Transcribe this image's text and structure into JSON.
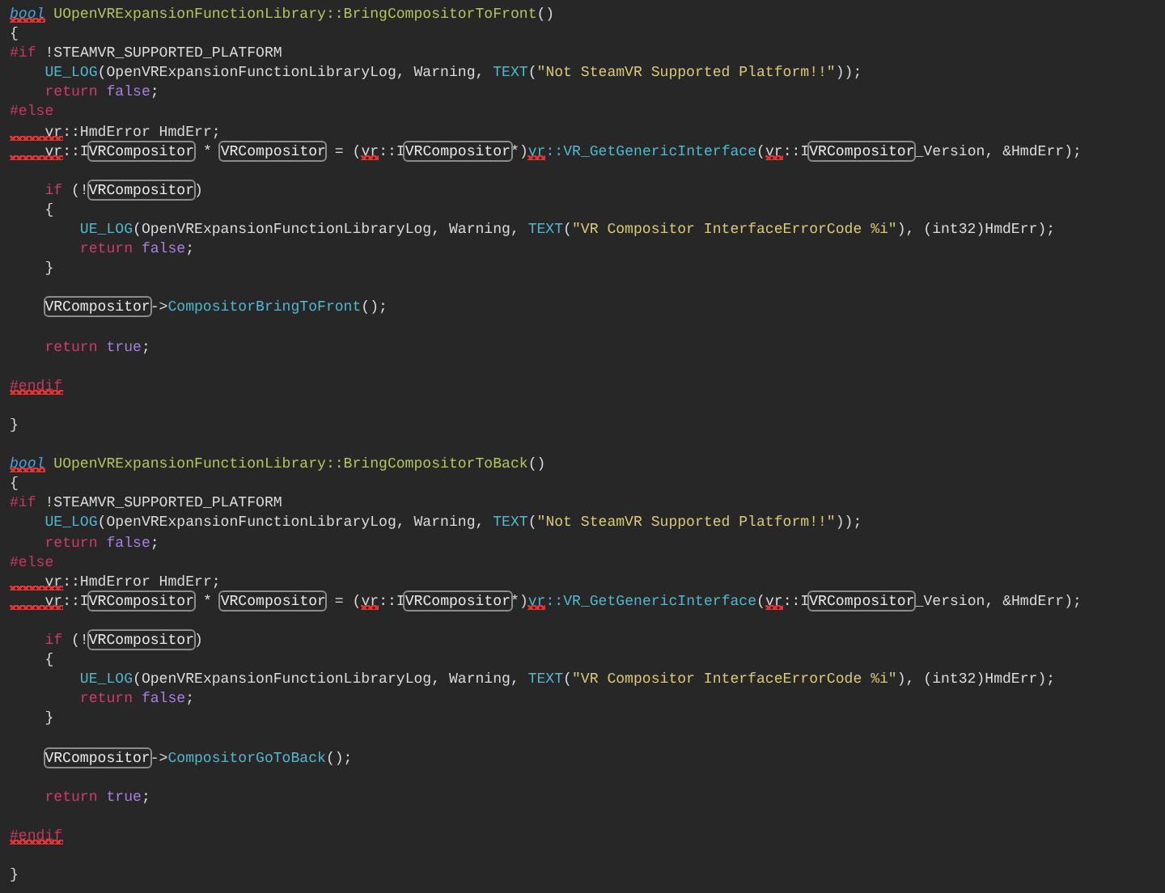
{
  "editor": {
    "lines": [
      {
        "kind": "code",
        "tokens": [
          {
            "text": "bool",
            "kind": "type",
            "error": true
          },
          {
            "text": " UOpenVRExpansionFunctionLibrary::BringCompositorToFront",
            "kind": "definition",
            "error": false
          },
          {
            "text": "()",
            "kind": "plain",
            "error": false
          }
        ]
      },
      {
        "kind": "code",
        "tokens": [
          {
            "text": "{",
            "kind": "plain",
            "error": false
          }
        ]
      },
      {
        "kind": "code",
        "tokens": [
          {
            "text": "#if",
            "kind": "preprocessor",
            "error": false
          },
          {
            "text": " !STEAMVR_SUPPORTED_PLATFORM",
            "kind": "plain",
            "error": false
          }
        ]
      },
      {
        "kind": "code",
        "tokens": [
          {
            "text": "    UE_LOG",
            "kind": "call",
            "error": false
          },
          {
            "text": "(OpenVRExpansionFunctionLibraryLog, Warning, ",
            "kind": "plain",
            "error": false
          },
          {
            "text": "TEXT",
            "kind": "call",
            "error": false
          },
          {
            "text": "(",
            "kind": "plain",
            "error": false
          },
          {
            "text": "\"Not SteamVR Supported Platform!!\"",
            "kind": "string",
            "error": false
          },
          {
            "text": "));",
            "kind": "plain",
            "error": false
          }
        ]
      },
      {
        "kind": "code",
        "tokens": [
          {
            "text": "    return",
            "kind": "keyword",
            "error": false
          },
          {
            "text": " false",
            "kind": "literal",
            "error": false
          },
          {
            "text": ";",
            "kind": "plain",
            "error": false
          }
        ]
      },
      {
        "kind": "code",
        "tokens": [
          {
            "text": "#else",
            "kind": "preprocessor",
            "error": false
          }
        ]
      },
      {
        "kind": "code",
        "tokens": [
          {
            "text": "    vr",
            "kind": "plain",
            "error": true
          },
          {
            "text": "::HmdError HmdErr;",
            "kind": "plain",
            "error": false
          }
        ]
      },
      {
        "kind": "code",
        "tokens": [
          {
            "text": "    vr",
            "kind": "plain",
            "error": true
          },
          {
            "text": "::I",
            "kind": "plain",
            "error": false
          },
          {
            "text": "VRCompositor",
            "kind": "match",
            "error": false
          },
          {
            "text": " * ",
            "kind": "plain",
            "error": false
          },
          {
            "text": "VRCompositor",
            "kind": "match",
            "error": false
          },
          {
            "text": " = (",
            "kind": "plain",
            "error": false
          },
          {
            "text": "vr",
            "kind": "plain",
            "error": true
          },
          {
            "text": "::I",
            "kind": "plain",
            "error": false
          },
          {
            "text": "VRCompositor",
            "kind": "match",
            "error": false
          },
          {
            "text": "*)",
            "kind": "plain",
            "error": false
          },
          {
            "text": "vr",
            "kind": "call",
            "error": true
          },
          {
            "text": "::VR_GetGenericInterface",
            "kind": "call",
            "error": false
          },
          {
            "text": "(",
            "kind": "plain",
            "error": false
          },
          {
            "text": "vr",
            "kind": "plain",
            "error": true
          },
          {
            "text": "::I",
            "kind": "plain",
            "error": false
          },
          {
            "text": "VRCompositor",
            "kind": "match",
            "error": false
          },
          {
            "text": "_Version, &HmdErr);",
            "kind": "plain",
            "error": false
          }
        ]
      },
      {
        "kind": "blank"
      },
      {
        "kind": "code",
        "tokens": [
          {
            "text": "    if",
            "kind": "keyword",
            "error": false
          },
          {
            "text": " (!",
            "kind": "plain",
            "error": false
          },
          {
            "text": "VRCompositor",
            "kind": "match",
            "error": false
          },
          {
            "text": ")",
            "kind": "plain",
            "error": false
          }
        ]
      },
      {
        "kind": "code",
        "tokens": [
          {
            "text": "    {",
            "kind": "plain",
            "error": false
          }
        ]
      },
      {
        "kind": "code",
        "tokens": [
          {
            "text": "        UE_LOG",
            "kind": "call",
            "error": false
          },
          {
            "text": "(OpenVRExpansionFunctionLibraryLog, Warning, ",
            "kind": "plain",
            "error": false
          },
          {
            "text": "TEXT",
            "kind": "call",
            "error": false
          },
          {
            "text": "(",
            "kind": "plain",
            "error": false
          },
          {
            "text": "\"VR Compositor InterfaceErrorCode %i\"",
            "kind": "string",
            "error": false
          },
          {
            "text": "), (int32)HmdErr);",
            "kind": "plain",
            "error": false
          }
        ]
      },
      {
        "kind": "code",
        "tokens": [
          {
            "text": "        return",
            "kind": "keyword",
            "error": false
          },
          {
            "text": " false",
            "kind": "literal",
            "error": false
          },
          {
            "text": ";",
            "kind": "plain",
            "error": false
          }
        ]
      },
      {
        "kind": "code",
        "tokens": [
          {
            "text": "    }",
            "kind": "plain",
            "error": false
          }
        ]
      },
      {
        "kind": "blank"
      },
      {
        "kind": "code-indented",
        "tokens": [
          {
            "text": "VRCompositor",
            "kind": "match",
            "error": false
          },
          {
            "text": "->",
            "kind": "plain",
            "error": false
          },
          {
            "text": "CompositorBringToFront",
            "kind": "call",
            "error": false
          },
          {
            "text": "();",
            "kind": "plain",
            "error": false
          }
        ]
      },
      {
        "kind": "blank"
      },
      {
        "kind": "code",
        "tokens": [
          {
            "text": "    return",
            "kind": "keyword",
            "error": false
          },
          {
            "text": " true",
            "kind": "literal",
            "error": false
          },
          {
            "text": ";",
            "kind": "plain",
            "error": false
          }
        ]
      },
      {
        "kind": "blank"
      },
      {
        "kind": "code",
        "tokens": [
          {
            "text": "#endif",
            "kind": "preprocessor",
            "error": true
          }
        ]
      },
      {
        "kind": "blank"
      },
      {
        "kind": "code",
        "tokens": [
          {
            "text": "}",
            "kind": "plain",
            "error": false
          }
        ]
      },
      {
        "kind": "blank"
      },
      {
        "kind": "code",
        "tokens": [
          {
            "text": "bool",
            "kind": "type",
            "error": true
          },
          {
            "text": " UOpenVRExpansionFunctionLibrary::BringCompositorToBack",
            "kind": "definition",
            "error": false
          },
          {
            "text": "()",
            "kind": "plain",
            "error": false
          }
        ]
      },
      {
        "kind": "code",
        "tokens": [
          {
            "text": "{",
            "kind": "plain",
            "error": false
          }
        ]
      },
      {
        "kind": "code",
        "tokens": [
          {
            "text": "#if",
            "kind": "preprocessor",
            "error": false
          },
          {
            "text": " !STEAMVR_SUPPORTED_PLATFORM",
            "kind": "plain",
            "error": false
          }
        ]
      },
      {
        "kind": "code",
        "tokens": [
          {
            "text": "    UE_LOG",
            "kind": "call",
            "error": false
          },
          {
            "text": "(OpenVRExpansionFunctionLibraryLog, Warning, ",
            "kind": "plain",
            "error": false
          },
          {
            "text": "TEXT",
            "kind": "call",
            "error": false
          },
          {
            "text": "(",
            "kind": "plain",
            "error": false
          },
          {
            "text": "\"Not SteamVR Supported Platform!!\"",
            "kind": "string",
            "error": false
          },
          {
            "text": "));",
            "kind": "plain",
            "error": false
          }
        ]
      },
      {
        "kind": "code",
        "tokens": [
          {
            "text": "    return",
            "kind": "keyword",
            "error": false
          },
          {
            "text": " false",
            "kind": "literal",
            "error": false
          },
          {
            "text": ";",
            "kind": "plain",
            "error": false
          }
        ]
      },
      {
        "kind": "code",
        "tokens": [
          {
            "text": "#else",
            "kind": "preprocessor",
            "error": false
          }
        ]
      },
      {
        "kind": "code",
        "tokens": [
          {
            "text": "    vr",
            "kind": "plain",
            "error": true
          },
          {
            "text": "::HmdError HmdErr;",
            "kind": "plain",
            "error": false
          }
        ]
      },
      {
        "kind": "code",
        "tokens": [
          {
            "text": "    vr",
            "kind": "plain",
            "error": true
          },
          {
            "text": "::I",
            "kind": "plain",
            "error": false
          },
          {
            "text": "VRCompositor",
            "kind": "match",
            "error": false
          },
          {
            "text": " * ",
            "kind": "plain",
            "error": false
          },
          {
            "text": "VRCompositor",
            "kind": "match",
            "error": false
          },
          {
            "text": " = (",
            "kind": "plain",
            "error": false
          },
          {
            "text": "vr",
            "kind": "plain",
            "error": true
          },
          {
            "text": "::I",
            "kind": "plain",
            "error": false
          },
          {
            "text": "VRCompositor",
            "kind": "match",
            "error": false
          },
          {
            "text": "*)",
            "kind": "plain",
            "error": false
          },
          {
            "text": "vr",
            "kind": "call",
            "error": true
          },
          {
            "text": "::VR_GetGenericInterface",
            "kind": "call",
            "error": false
          },
          {
            "text": "(",
            "kind": "plain",
            "error": false
          },
          {
            "text": "vr",
            "kind": "plain",
            "error": true
          },
          {
            "text": "::I",
            "kind": "plain",
            "error": false
          },
          {
            "text": "VRCompositor",
            "kind": "match",
            "error": false
          },
          {
            "text": "_Version, &HmdErr);",
            "kind": "plain",
            "error": false
          }
        ]
      },
      {
        "kind": "blank"
      },
      {
        "kind": "code",
        "tokens": [
          {
            "text": "    if",
            "kind": "keyword",
            "error": false
          },
          {
            "text": " (!",
            "kind": "plain",
            "error": false
          },
          {
            "text": "VRCompositor",
            "kind": "match",
            "error": false
          },
          {
            "text": ")",
            "kind": "plain",
            "error": false
          }
        ]
      },
      {
        "kind": "code",
        "tokens": [
          {
            "text": "    {",
            "kind": "plain",
            "error": false
          }
        ]
      },
      {
        "kind": "code",
        "tokens": [
          {
            "text": "        UE_LOG",
            "kind": "call",
            "error": false
          },
          {
            "text": "(OpenVRExpansionFunctionLibraryLog, Warning, ",
            "kind": "plain",
            "error": false
          },
          {
            "text": "TEXT",
            "kind": "call",
            "error": false
          },
          {
            "text": "(",
            "kind": "plain",
            "error": false
          },
          {
            "text": "\"VR Compositor InterfaceErrorCode %i\"",
            "kind": "string",
            "error": false
          },
          {
            "text": "), (int32)HmdErr);",
            "kind": "plain",
            "error": false
          }
        ]
      },
      {
        "kind": "code",
        "tokens": [
          {
            "text": "        return",
            "kind": "keyword",
            "error": false
          },
          {
            "text": " false",
            "kind": "literal",
            "error": false
          },
          {
            "text": ";",
            "kind": "plain",
            "error": false
          }
        ]
      },
      {
        "kind": "code",
        "tokens": [
          {
            "text": "    }",
            "kind": "plain",
            "error": false
          }
        ]
      },
      {
        "kind": "blank"
      },
      {
        "kind": "code-indented",
        "tokens": [
          {
            "text": "VRCompositor",
            "kind": "match",
            "error": false
          },
          {
            "text": "->",
            "kind": "plain",
            "error": false
          },
          {
            "text": "CompositorGoToBack",
            "kind": "call",
            "error": false
          },
          {
            "text": "();",
            "kind": "plain",
            "error": false
          }
        ]
      },
      {
        "kind": "blank"
      },
      {
        "kind": "code",
        "tokens": [
          {
            "text": "    return",
            "kind": "keyword",
            "error": false
          },
          {
            "text": " true",
            "kind": "literal",
            "error": false
          },
          {
            "text": ";",
            "kind": "plain",
            "error": false
          }
        ]
      },
      {
        "kind": "blank"
      },
      {
        "kind": "code",
        "tokens": [
          {
            "text": "#endif",
            "kind": "preprocessor",
            "error": true
          }
        ]
      },
      {
        "kind": "blank"
      },
      {
        "kind": "code",
        "tokens": [
          {
            "text": "}",
            "kind": "plain",
            "error": false
          }
        ]
      }
    ]
  }
}
